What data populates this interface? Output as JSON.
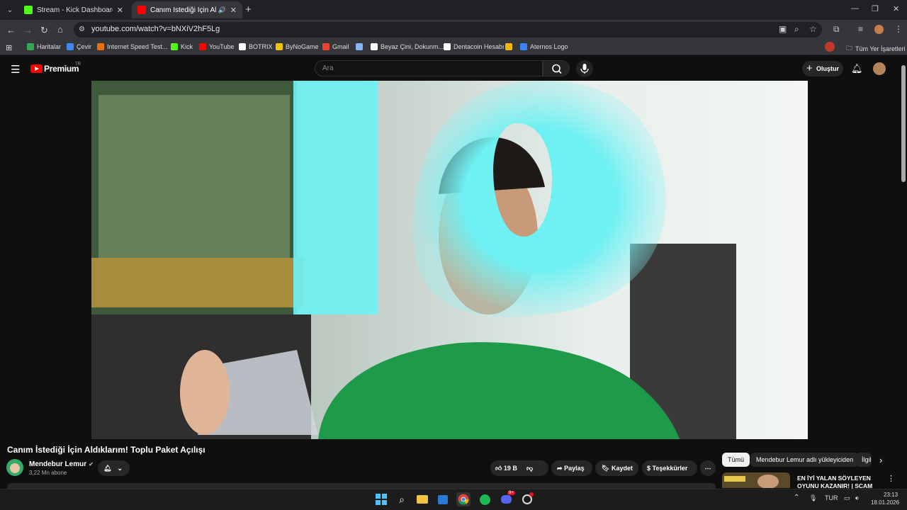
{
  "browser": {
    "tabs": [
      {
        "title": "Stream - Kick Dashboard",
        "active": false,
        "color": "#53fc18"
      },
      {
        "title": "Canım İstediği İçin Aldıklarım",
        "active": true,
        "color": "#ff0000"
      }
    ],
    "url": "youtube.com/watch?v=bNXiV2hF5Lg",
    "bookmarks": [
      {
        "label": "Haritalar",
        "icon": "maps-icon",
        "color": "#34a853"
      },
      {
        "label": "Çevir",
        "icon": "translate-icon",
        "color": "#4285f4"
      },
      {
        "label": "Internet Speed Test...",
        "icon": "speedtest-icon",
        "color": "#e8710a"
      },
      {
        "label": "Kick",
        "icon": "kick-icon",
        "color": "#53fc18"
      },
      {
        "label": "YouTube",
        "icon": "youtube-icon",
        "color": "#ff0000"
      },
      {
        "label": "BOTRIX",
        "icon": "botrix-icon",
        "color": "#ffffff"
      },
      {
        "label": "ByNoGame",
        "icon": "bynogame-icon",
        "color": "#f5c400"
      },
      {
        "label": "Gmail",
        "icon": "gmail-icon",
        "color": "#ea4335"
      },
      {
        "label": "",
        "icon": "globe-icon",
        "color": "#8ab4f8"
      },
      {
        "label": "Beyaz Çini, Dokunm...",
        "icon": "checker-icon",
        "color": "#ffffff"
      },
      {
        "label": "Dentacoin Hesabı",
        "icon": "dentacoin-icon",
        "color": "#ffffff"
      },
      {
        "label": "",
        "icon": "binance-icon",
        "color": "#f0b90b"
      },
      {
        "label": "Aternos Logo",
        "icon": "aternos-icon",
        "color": "#3b82f6"
      }
    ],
    "all_bookmarks": "Tüm Yer İşaretleri"
  },
  "youtube": {
    "logo": "Premium",
    "region": "TR",
    "search_placeholder": "Ara",
    "create_label": "Oluştur",
    "video_title": "Canım İstediği İçin Aldıklarım! Toplu Paket Açılışı",
    "channel_name": "Mendebur Lemur",
    "subscribers": "3,22 Mn abone",
    "like_count": "19 B",
    "share_label": "Paylaş",
    "save_label": "Kaydet",
    "thanks_label": "Teşekkürler",
    "chips": [
      "Tümü",
      "Mendebur Lemur adlı yükleyiciden",
      "İlgili"
    ],
    "recommended_title": "EN İYİ YALAN SÖYLEYEN OYUNU KAZANIR! | SCAM LIN"
  },
  "taskbar": {
    "language": "TUR",
    "time": "23:13",
    "date": "18.01.2026",
    "discord_badge": "9+"
  }
}
